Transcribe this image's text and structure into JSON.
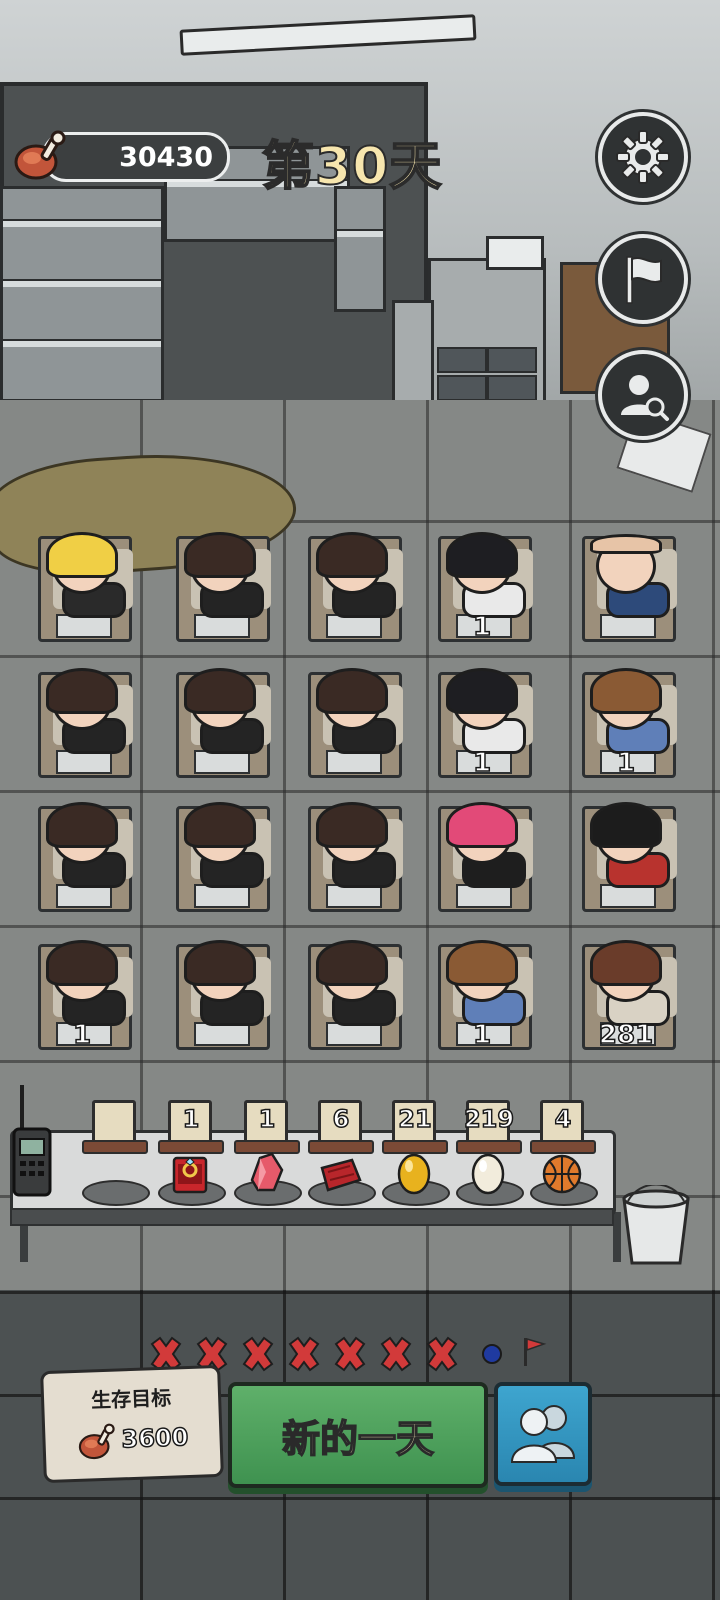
{
  "hud": {
    "food_total": "30430",
    "food_icon": "meat-icon",
    "day_label": "第30天"
  },
  "side_buttons": [
    {
      "name": "settings-button",
      "icon": "gear-icon"
    },
    {
      "name": "flag-button",
      "icon": "flag-icon"
    },
    {
      "name": "profile-search-button",
      "icon": "user-search-icon"
    }
  ],
  "beds": [
    {
      "row": 1,
      "col": 1,
      "character": "blonde-vampire",
      "count": ""
    },
    {
      "row": 1,
      "col": 2,
      "character": "ponytail-girl",
      "count": ""
    },
    {
      "row": 1,
      "col": 3,
      "character": "ponytail-girl",
      "count": ""
    },
    {
      "row": 1,
      "col": 4,
      "character": "black-haired-boy",
      "count": "1"
    },
    {
      "row": 1,
      "col": 5,
      "character": "bald-old-man",
      "count": ""
    },
    {
      "row": 2,
      "col": 1,
      "character": "ponytail-girl",
      "count": ""
    },
    {
      "row": 2,
      "col": 2,
      "character": "ponytail-girl",
      "count": ""
    },
    {
      "row": 2,
      "col": 3,
      "character": "ponytail-girl",
      "count": ""
    },
    {
      "row": 2,
      "col": 4,
      "character": "black-haired-boy",
      "count": "1"
    },
    {
      "row": 2,
      "col": 5,
      "character": "brown-haired-girl",
      "count": "1"
    },
    {
      "row": 3,
      "col": 1,
      "character": "ponytail-girl",
      "count": ""
    },
    {
      "row": 3,
      "col": 2,
      "character": "ponytail-girl",
      "count": ""
    },
    {
      "row": 3,
      "col": 3,
      "character": "ponytail-girl",
      "count": ""
    },
    {
      "row": 3,
      "col": 4,
      "character": "pink-haired-girl",
      "count": ""
    },
    {
      "row": 3,
      "col": 5,
      "character": "sunglasses-man",
      "count": ""
    },
    {
      "row": 4,
      "col": 1,
      "character": "ponytail-girl",
      "count": "1"
    },
    {
      "row": 4,
      "col": 2,
      "character": "ponytail-girl",
      "count": ""
    },
    {
      "row": 4,
      "col": 3,
      "character": "ponytail-girl",
      "count": ""
    },
    {
      "row": 4,
      "col": 4,
      "character": "brown-haired-girl",
      "count": "1"
    },
    {
      "row": 4,
      "col": 5,
      "character": "injured-boy",
      "count": "281"
    }
  ],
  "items": [
    {
      "name": "empty",
      "count": "",
      "icon": "empty-slot"
    },
    {
      "name": "ring",
      "count": "1",
      "icon": "ring-box-icon"
    },
    {
      "name": "crystal",
      "count": "1",
      "icon": "crystal-icon"
    },
    {
      "name": "meat",
      "count": "6",
      "icon": "raw-meat-icon"
    },
    {
      "name": "golden-egg",
      "count": "21",
      "icon": "golden-egg-icon"
    },
    {
      "name": "egg",
      "count": "219",
      "icon": "egg-icon"
    },
    {
      "name": "basketball",
      "count": "4",
      "icon": "basketball-icon"
    }
  ],
  "progress": {
    "failed_days": 7,
    "current_marker": "dot",
    "goal_marker": "flag-icon"
  },
  "goal": {
    "title": "生存目标",
    "value": "3600"
  },
  "buttons": {
    "new_day": "新的一天",
    "team_icon": "team-icon"
  },
  "colors": {
    "new_day_green": "#4fa35e",
    "team_blue": "#34a0c9",
    "fail_red": "#d23a3a",
    "day_text": "#f7e6ae"
  }
}
